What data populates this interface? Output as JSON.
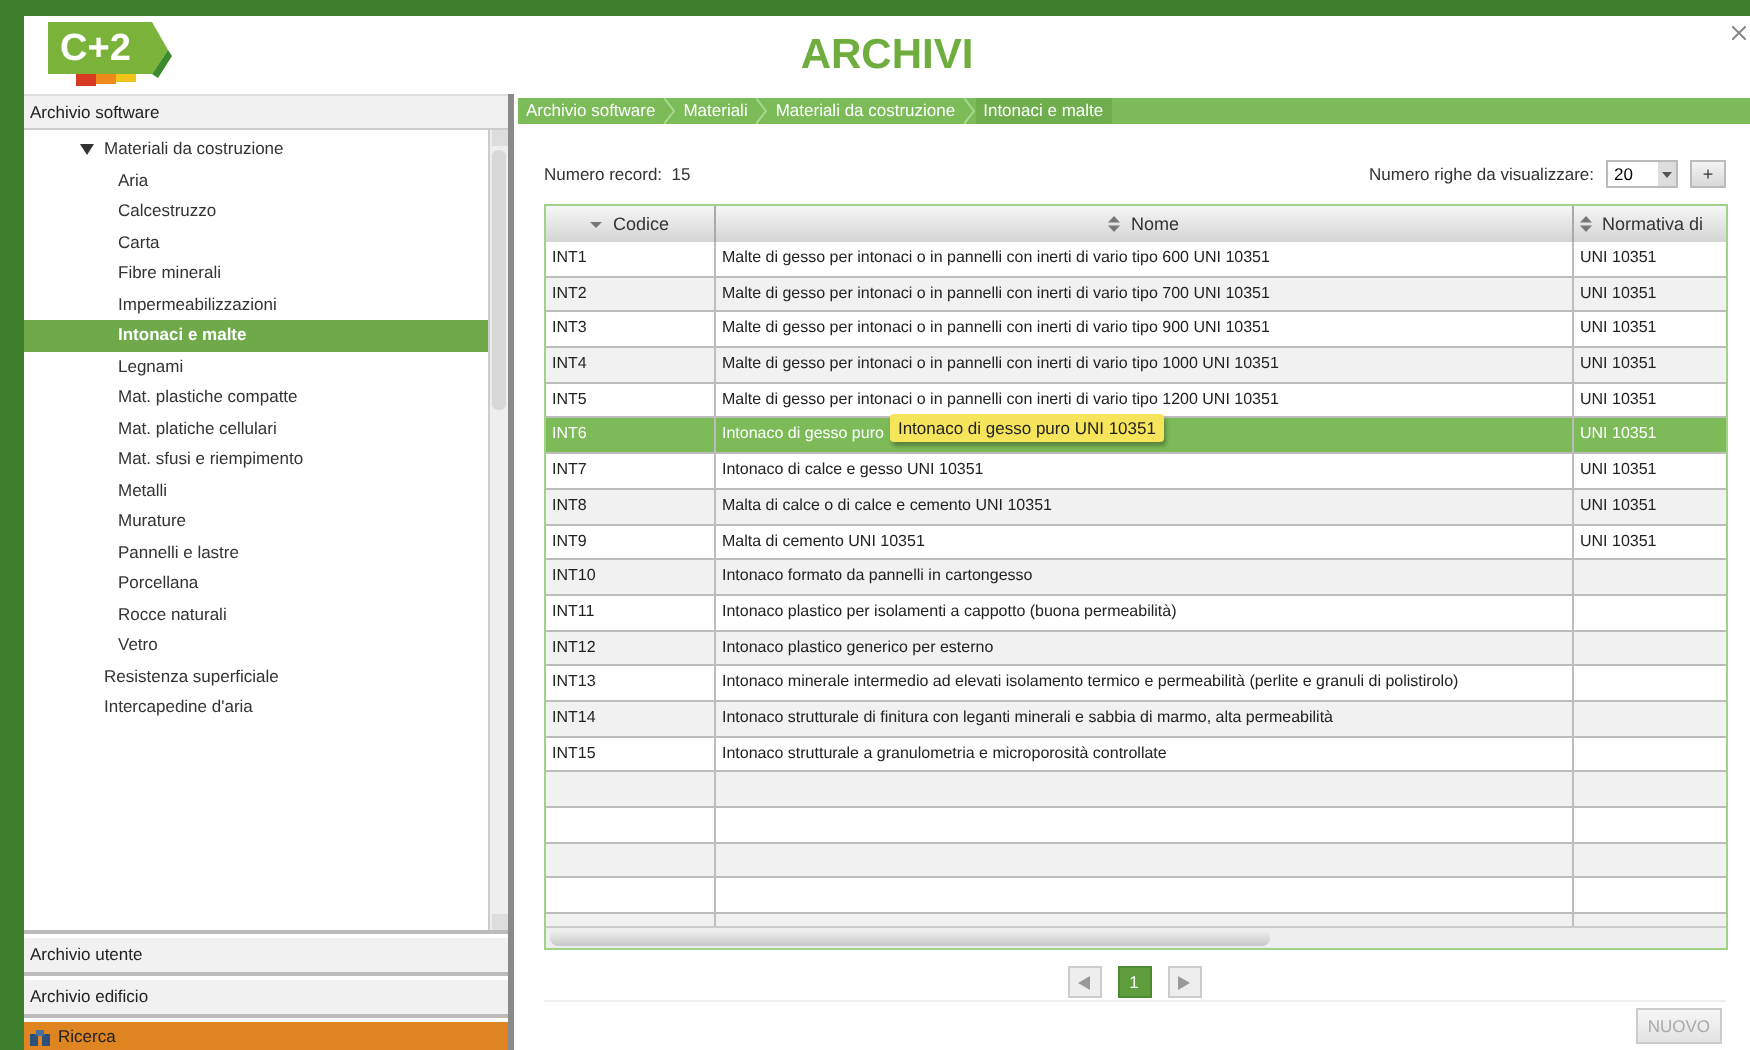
{
  "header": {
    "logo": "C+2",
    "title": "ARCHIVI"
  },
  "sidebar": {
    "section_title": "Archivio software",
    "tree": [
      {
        "label": "Materiali da costruzione",
        "expanded": true,
        "selected": false,
        "children": [
          {
            "label": "Aria",
            "selected": false
          },
          {
            "label": "Calcestruzzo",
            "selected": false
          },
          {
            "label": "Carta",
            "selected": false
          },
          {
            "label": "Fibre minerali",
            "selected": false
          },
          {
            "label": "Impermeabilizzazioni",
            "selected": false
          },
          {
            "label": "Intonaci e malte",
            "selected": true
          },
          {
            "label": "Legnami",
            "selected": false
          },
          {
            "label": "Mat. plastiche compatte",
            "selected": false
          },
          {
            "label": "Mat. platiche cellulari",
            "selected": false
          },
          {
            "label": "Mat. sfusi e riempimento",
            "selected": false
          },
          {
            "label": "Metalli",
            "selected": false
          },
          {
            "label": "Murature",
            "selected": false
          },
          {
            "label": "Pannelli e lastre",
            "selected": false
          },
          {
            "label": "Porcellana",
            "selected": false
          },
          {
            "label": "Rocce naturali",
            "selected": false
          },
          {
            "label": "Vetro",
            "selected": false
          }
        ]
      },
      {
        "label": "Resistenza superficiale",
        "selected": false
      },
      {
        "label": "Intercapedine d'aria",
        "selected": false
      }
    ],
    "panels": [
      {
        "label": "Archivio utente",
        "kind": "accordion"
      },
      {
        "label": "Archivio edificio",
        "kind": "accordion"
      },
      {
        "label": "Ricerca",
        "kind": "search"
      }
    ]
  },
  "breadcrumb": [
    "Archivio software",
    "Materiali",
    "Materiali da costruzione",
    "Intonaci e malte"
  ],
  "record_count": {
    "label": "Numero record:",
    "value": "15"
  },
  "rows_per_page": {
    "label": "Numero righe da visualizzare:",
    "value": "20",
    "add_button": "+"
  },
  "table": {
    "columns": [
      {
        "label": "Codice",
        "kind": "descending"
      },
      {
        "label": "Nome",
        "kind": "sortable"
      },
      {
        "label": "Normativa di",
        "kind": "sortable"
      }
    ],
    "rows": [
      {
        "cells": [
          "INT1",
          "Malte di gesso per intonaci o in pannelli con inerti di vario tipo 600 UNI 10351",
          "UNI 10351"
        ],
        "selected": false
      },
      {
        "cells": [
          "INT2",
          "Malte di gesso per intonaci o in pannelli con inerti di vario tipo 700 UNI 10351",
          "UNI 10351"
        ],
        "selected": false
      },
      {
        "cells": [
          "INT3",
          "Malte di gesso per intonaci o in pannelli con inerti di vario tipo 900 UNI 10351",
          "UNI 10351"
        ],
        "selected": false
      },
      {
        "cells": [
          "INT4",
          "Malte di gesso per intonaci o in pannelli con inerti di vario tipo 1000 UNI 10351",
          "UNI 10351"
        ],
        "selected": false
      },
      {
        "cells": [
          "INT5",
          "Malte di gesso per intonaci o in pannelli con inerti di vario tipo 1200 UNI 10351",
          "UNI 10351"
        ],
        "selected": false
      },
      {
        "cells": [
          "INT6",
          "Intonaco di gesso puro",
          "UNI 10351"
        ],
        "selected": true,
        "tooltip": "Intonaco di gesso puro UNI 10351"
      },
      {
        "cells": [
          "INT7",
          "Intonaco di calce e gesso UNI 10351",
          "UNI 10351"
        ],
        "selected": false
      },
      {
        "cells": [
          "INT8",
          "Malta di calce o di calce e cemento UNI 10351",
          "UNI 10351"
        ],
        "selected": false
      },
      {
        "cells": [
          "INT9",
          "Malta di cemento UNI 10351",
          "UNI 10351"
        ],
        "selected": false
      },
      {
        "cells": [
          "INT10",
          "Intonaco formato da pannelli in cartongesso",
          ""
        ],
        "selected": false
      },
      {
        "cells": [
          "INT11",
          "Intonaco plastico per isolamenti a cappotto (buona permeabilità)",
          ""
        ],
        "selected": false
      },
      {
        "cells": [
          "INT12",
          "Intonaco plastico generico per esterno",
          ""
        ],
        "selected": false
      },
      {
        "cells": [
          "INT13",
          "Intonaco minerale intermedio ad elevati isolamento termico e permeabilità (perlite e granuli di polistirolo)",
          ""
        ],
        "selected": false
      },
      {
        "cells": [
          "INT14",
          "Intonaco strutturale di finitura con leganti minerali e sabbia di marmo, alta permeabilità",
          ""
        ],
        "selected": false
      },
      {
        "cells": [
          "INT15",
          "Intonaco strutturale a granulometria e microporosità controllate",
          ""
        ],
        "selected": false
      }
    ]
  },
  "pagination": {
    "pages": [
      {
        "label": "1",
        "selected": true
      }
    ]
  },
  "new_button": {
    "label": "NUOVO",
    "disabled": true
  }
}
